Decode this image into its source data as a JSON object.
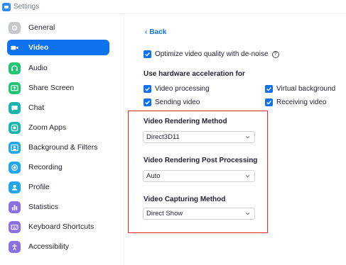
{
  "window": {
    "title": "Settings"
  },
  "sidebar": {
    "items": [
      {
        "label": "General",
        "icon": "gear-icon",
        "color": "#c6c9cc"
      },
      {
        "label": "Video",
        "icon": "video-camera-icon",
        "color": "#0e72ed",
        "active": true
      },
      {
        "label": "Audio",
        "icon": "headphones-icon",
        "color": "#23c474"
      },
      {
        "label": "Share Screen",
        "icon": "share-screen-icon",
        "color": "#23c474"
      },
      {
        "label": "Chat",
        "icon": "chat-bubble-icon",
        "color": "#1bb5b0"
      },
      {
        "label": "Zoom Apps",
        "icon": "apps-icon",
        "color": "#1bb5b0"
      },
      {
        "label": "Background & Filters",
        "icon": "person-background-icon",
        "color": "#21a6e8"
      },
      {
        "label": "Recording",
        "icon": "record-icon",
        "color": "#21a6e8"
      },
      {
        "label": "Profile",
        "icon": "profile-icon",
        "color": "#21a6e8"
      },
      {
        "label": "Statistics",
        "icon": "bar-chart-icon",
        "color": "#8a6fe0"
      },
      {
        "label": "Keyboard Shortcuts",
        "icon": "keyboard-icon",
        "color": "#8a6fe0"
      },
      {
        "label": "Accessibility",
        "icon": "accessibility-icon",
        "color": "#8a6fe0"
      }
    ]
  },
  "content": {
    "back_label": "Back",
    "optimize_label": "Optimize video quality with de-noise",
    "hw_accel_title": "Use hardware acceleration for",
    "video_processing_label": "Video processing",
    "virtual_background_label": "Virtual background",
    "sending_video_label": "Sending video",
    "receiving_video_label": "Receiving video",
    "rendering_method_title": "Video Rendering Method",
    "rendering_method_value": "Direct3D11",
    "post_processing_title": "Video Rendering Post Processing",
    "post_processing_value": "Auto",
    "capturing_method_title": "Video Capturing Method",
    "capturing_method_value": "Direct Show"
  },
  "colors": {
    "accent": "#0e72ed",
    "highlight": "#e02828"
  }
}
